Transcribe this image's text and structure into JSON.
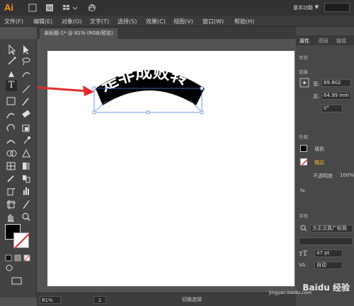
{
  "app": {
    "logo": "Ai",
    "workspace": "基本功能",
    "workspace_arrow": "▼"
  },
  "menu": [
    {
      "label": "文件(F)"
    },
    {
      "label": "编辑(E)"
    },
    {
      "label": "对象(O)"
    },
    {
      "label": "文字(T)"
    },
    {
      "label": "选择(S)"
    },
    {
      "label": "效果(C)"
    },
    {
      "label": "视图(V)"
    },
    {
      "label": "窗口(W)"
    },
    {
      "label": "帮助(H)"
    }
  ],
  "document": {
    "tab_label": "未标题-1* @ 81% (RGB/预览)",
    "close": "×"
  },
  "artwork": {
    "text": "是非成败转",
    "text_color": "#ffffff",
    "shape_color": "#000000",
    "arrow_color": "#e32b2b"
  },
  "statusbar": {
    "zoom": "81%",
    "page": "1",
    "status": "切换选择"
  },
  "panel": {
    "tabs": {
      "properties": "属性",
      "other1": "图层",
      "other2": "链接"
    },
    "section_char": "字符",
    "section_transform": "变换",
    "x_label": "宽:",
    "x_value": "89.802",
    "y_label": "高:",
    "y_value": "64.99 mm",
    "angle": "0°",
    "section_appearance": "外观",
    "fill_label": "填色",
    "stroke_label": "描边",
    "opacity_label": "不透明度",
    "opacity_value": "100%",
    "fx_label": "fx.",
    "section_char2": "字符",
    "font_name": "方正汉真广标简",
    "font_size": "47 pt",
    "tracking": "自动"
  },
  "watermark": {
    "text": "Baidu 经验",
    "url": "jingyan.baidu.com"
  }
}
